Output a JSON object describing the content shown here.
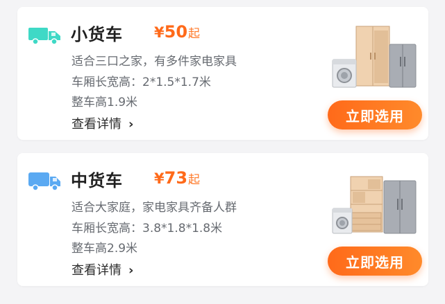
{
  "vehicles": [
    {
      "name": "小货车",
      "price_symbol": "¥",
      "price": "50",
      "price_suffix": "起",
      "desc1": "适合三口之家，有多件家电家具",
      "desc2": "车厢长宽高：2*1.5*1.7米",
      "desc3": "整车高1.9米",
      "details_label": "查看详情",
      "button_label": "立即选用",
      "truck_color": "#3fd9c6"
    },
    {
      "name": "中货车",
      "price_symbol": "¥",
      "price": "73",
      "price_suffix": "起",
      "desc1": "适合大家庭，家电家具齐备人群",
      "desc2": "车厢长宽高：3.8*1.8*1.8米",
      "desc3": "整车高2.9米",
      "details_label": "查看详情",
      "button_label": "立即选用",
      "truck_color": "#5aa9f2"
    }
  ],
  "colors": {
    "accent": "#ff6a1a",
    "text_primary": "#1f1f1f",
    "text_secondary": "#666a70",
    "card_bg": "#ffffff",
    "page_bg": "#f4f4f6"
  },
  "icons": {
    "details_chevron": "chevron-right-icon",
    "truck_small": "small-truck-icon",
    "truck_medium": "medium-truck-icon"
  }
}
